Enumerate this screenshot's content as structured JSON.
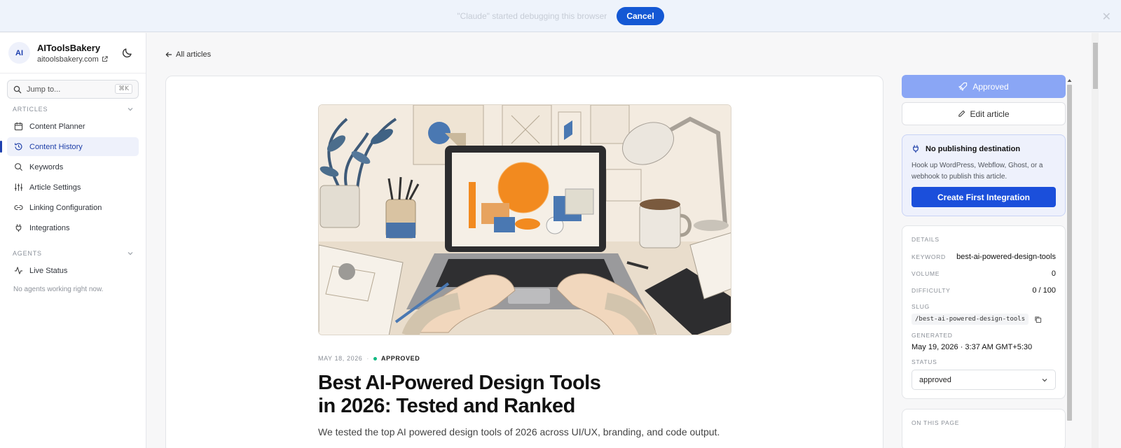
{
  "banner": {
    "message": "\"Claude\" started debugging this browser",
    "cancel_label": "Cancel"
  },
  "sidebar": {
    "brand_initials": "AI",
    "brand_name": "AIToolsBakery",
    "brand_domain": "aitoolsbakery.com",
    "jump_placeholder": "Jump to...",
    "jump_shortcut": "⌘K",
    "articles_label": "ARTICLES",
    "items": [
      {
        "label": "Content Planner",
        "icon": "calendar-icon"
      },
      {
        "label": "Content History",
        "icon": "history-icon",
        "active": true
      },
      {
        "label": "Keywords",
        "icon": "search-icon"
      },
      {
        "label": "Article Settings",
        "icon": "sliders-icon"
      },
      {
        "label": "Linking Configuration",
        "icon": "link-icon"
      },
      {
        "label": "Integrations",
        "icon": "plug-icon"
      }
    ],
    "agents_label": "AGENTS",
    "live_status_label": "Live Status",
    "agents_empty": "No agents working right now."
  },
  "main": {
    "back_label": "All articles",
    "date": "MAY 18, 2026",
    "separator": "·",
    "status": "APPROVED",
    "title_line1": "Best AI-Powered Design Tools",
    "title_line2": "in 2026: Tested and Ranked",
    "lede": "We tested the top AI powered design tools of 2026 across UI/UX, branding, and code output."
  },
  "panel": {
    "approved_label": "Approved",
    "edit_label": "Edit article",
    "publish_title": "No publishing destination",
    "publish_desc": "Hook up WordPress, Webflow, Ghost, or a webhook to publish this article.",
    "create_label": "Create First Integration",
    "details_label": "DETAILS",
    "keyword_label": "KEYWORD",
    "keyword_value": "best-ai-powered-design-tools",
    "volume_label": "VOLUME",
    "volume_value": "0",
    "difficulty_label": "DIFFICULTY",
    "difficulty_value": "0 / 100",
    "slug_label": "SLUG",
    "slug_value": "/best-ai-powered-design-tools",
    "generated_label": "GENERATED",
    "generated_value": "May 19, 2026 · 3:37 AM GMT+5:30",
    "status_label": "STATUS",
    "status_value": "approved",
    "toc_label": "ON THIS PAGE"
  },
  "colors": {
    "accent": "#1b4fdb",
    "approved_button": "#8aa6f5",
    "status_dot": "#10b981",
    "sidebar_active_bg": "#eef1fb"
  }
}
